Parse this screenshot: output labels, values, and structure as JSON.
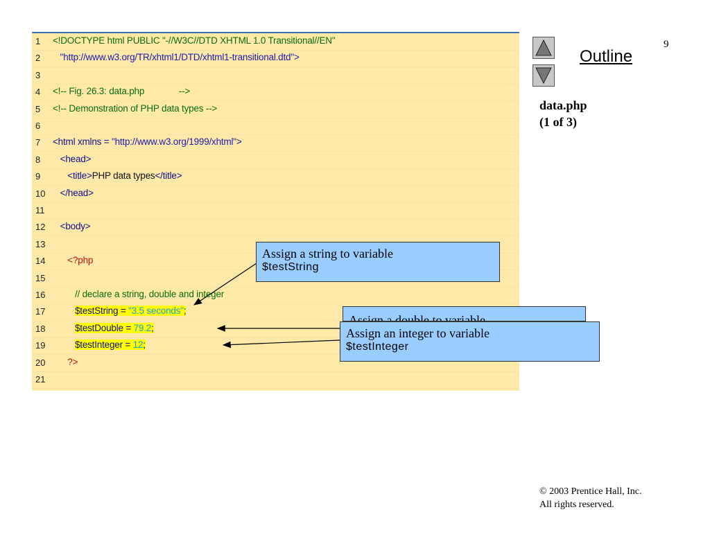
{
  "slide_number": "9",
  "outline": {
    "title": "Outline",
    "up_icon": "triangle-up-icon",
    "down_icon": "triangle-down-icon"
  },
  "file_label": {
    "line1": "data.php",
    "line2": "(1 of 3)"
  },
  "code": {
    "lines": [
      {
        "n": "1",
        "segments": [
          {
            "text": "<!DOCTYPE html PUBLIC \"-//W3C//DTD XHTML 1.0 Transitional//EN\"",
            "color": "green"
          }
        ]
      },
      {
        "n": "2",
        "segments": [
          {
            "text": "   \"http://www.w3.org/TR/xhtml1/DTD/xhtml1-transitional.dtd\">",
            "color": "blue"
          }
        ]
      },
      {
        "n": "3",
        "segments": []
      },
      {
        "n": "4",
        "segments": [
          {
            "text": "<!-- Fig. 26.3: data.php              -->",
            "color": "green"
          }
        ]
      },
      {
        "n": "5",
        "segments": [
          {
            "text": "<!-- Demonstration of PHP data types -->",
            "color": "green"
          }
        ]
      },
      {
        "n": "6",
        "segments": []
      },
      {
        "n": "7",
        "segments": [
          {
            "text": "<html xmlns = ",
            "color": "navy"
          },
          {
            "text": "\"http://www.w3.org/1999/xhtml\"",
            "color": "blue"
          },
          {
            "text": ">",
            "color": "navy"
          }
        ]
      },
      {
        "n": "8",
        "segments": [
          {
            "text": "   <head>",
            "color": "navy"
          }
        ]
      },
      {
        "n": "9",
        "segments": [
          {
            "text": "      <title>",
            "color": "navy"
          },
          {
            "text": "PHP data types",
            "color": "black"
          },
          {
            "text": "</title>",
            "color": "navy"
          }
        ]
      },
      {
        "n": "10",
        "segments": [
          {
            "text": "   </head>",
            "color": "navy"
          }
        ]
      },
      {
        "n": "11",
        "segments": []
      },
      {
        "n": "12",
        "segments": [
          {
            "text": "   <body>",
            "color": "navy"
          }
        ]
      },
      {
        "n": "13",
        "segments": []
      },
      {
        "n": "14",
        "segments": [
          {
            "text": "      <?php",
            "color": "red"
          }
        ]
      },
      {
        "n": "15",
        "segments": []
      },
      {
        "n": "16",
        "segments": [
          {
            "text": "         // declare a string, double and integer",
            "color": "green"
          }
        ]
      },
      {
        "n": "17",
        "segments": [
          {
            "text": "         ",
            "color": "black"
          },
          {
            "text": "$testString = ",
            "color": "navy",
            "hl": true
          },
          {
            "text": "\"3.5 seconds\"",
            "color": "cyan",
            "hl": true
          },
          {
            "text": ";",
            "color": "navy",
            "hl": true
          }
        ]
      },
      {
        "n": "18",
        "segments": [
          {
            "text": "         ",
            "color": "black"
          },
          {
            "text": "$testDouble = ",
            "color": "navy",
            "hl": true
          },
          {
            "text": "79.2",
            "color": "cyan",
            "hl": true
          },
          {
            "text": ";",
            "color": "navy",
            "hl": true
          }
        ]
      },
      {
        "n": "19",
        "segments": [
          {
            "text": "         ",
            "color": "black"
          },
          {
            "text": "$testInteger = ",
            "color": "navy",
            "hl": true
          },
          {
            "text": "12",
            "color": "cyan",
            "hl": true
          },
          {
            "text": ";",
            "color": "navy",
            "hl": true
          }
        ]
      },
      {
        "n": "20",
        "segments": [
          {
            "text": "      ?>",
            "color": "red"
          }
        ]
      },
      {
        "n": "21",
        "segments": []
      }
    ]
  },
  "callouts": {
    "string": {
      "text": "Assign a string to variable",
      "var": "$testString"
    },
    "double": {
      "text": "Assign a double to variable"
    },
    "integer": {
      "text": "Assign an integer to variable",
      "var": "$testInteger"
    }
  },
  "copyright": {
    "line1": "© 2003 Prentice Hall, Inc.",
    "line2": "All rights reserved."
  }
}
